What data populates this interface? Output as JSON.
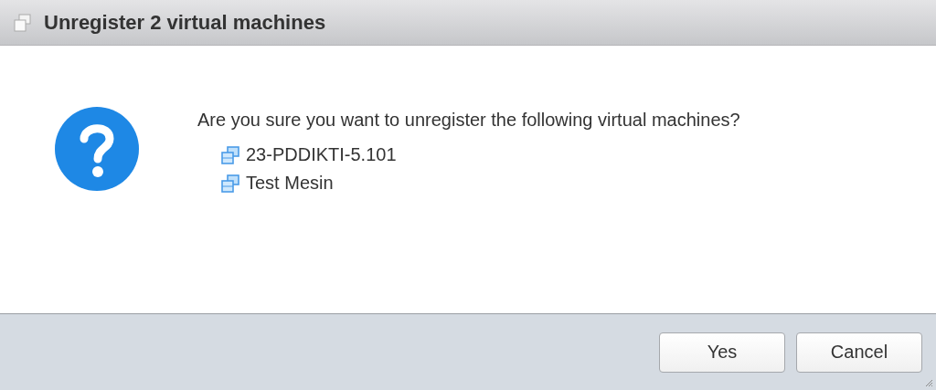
{
  "window": {
    "title": "Unregister 2 virtual machines"
  },
  "message": "Are you sure you want to unregister the following virtual machines?",
  "machines": [
    {
      "name": "23-PDDIKTI-5.101"
    },
    {
      "name": "Test Mesin"
    }
  ],
  "buttons": [
    {
      "label": "Yes"
    },
    {
      "label": "Cancel"
    }
  ]
}
